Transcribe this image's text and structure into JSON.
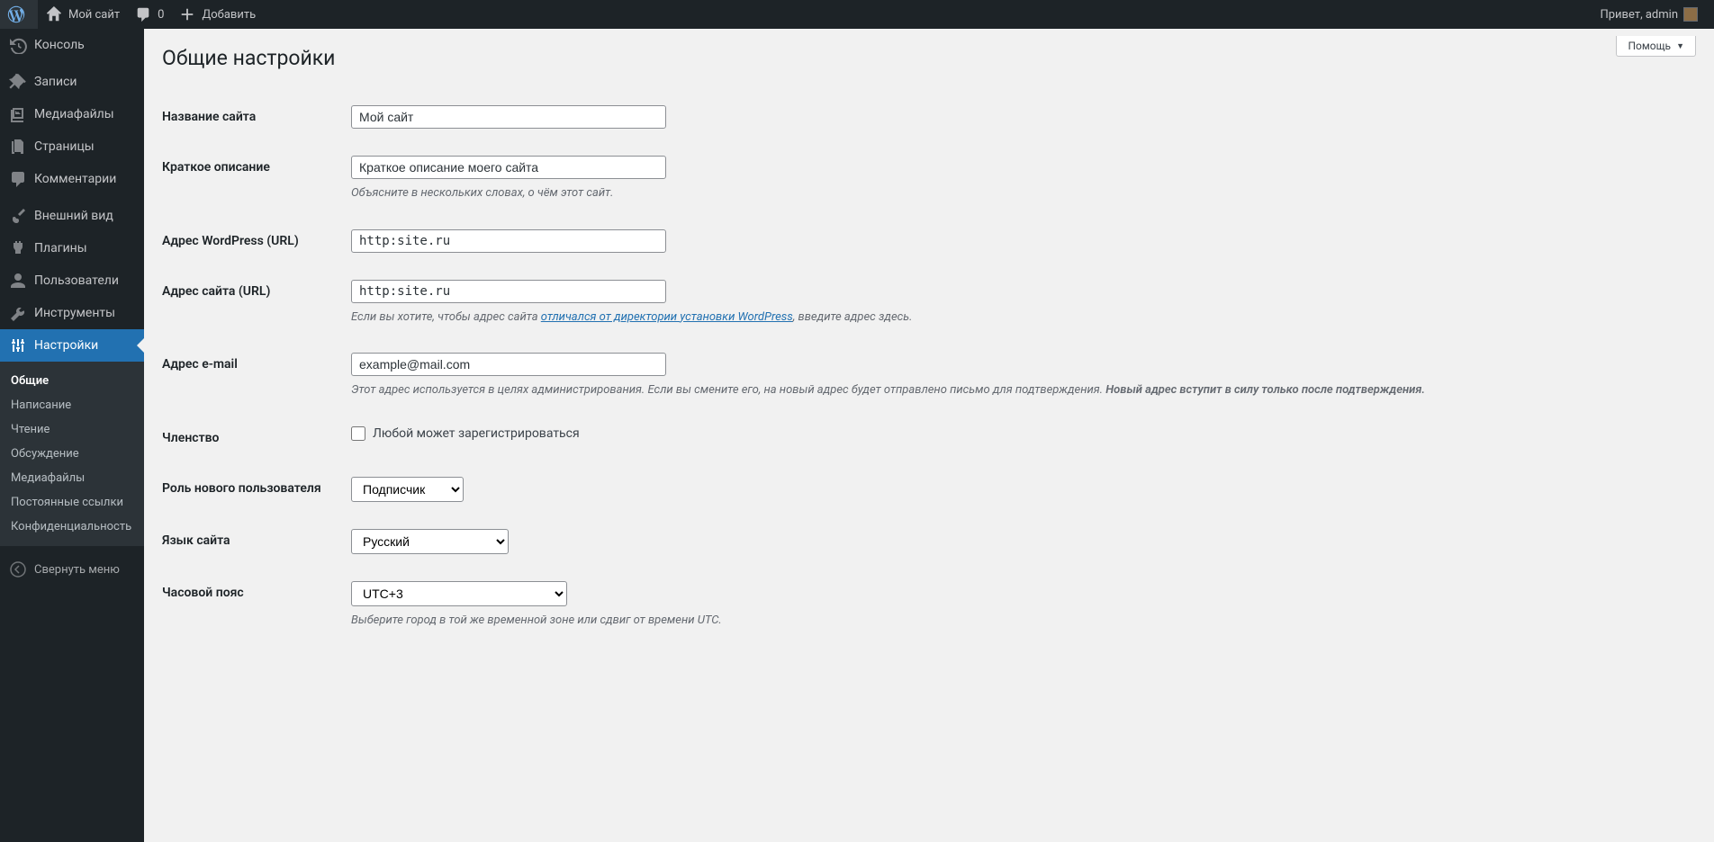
{
  "adminbar": {
    "site_name": "Мой сайт",
    "comments_count": "0",
    "add_new": "Добавить",
    "greeting": "Привет, admin"
  },
  "sidebar": {
    "items": [
      {
        "label": "Консоль"
      },
      {
        "label": "Записи"
      },
      {
        "label": "Медиафайлы"
      },
      {
        "label": "Страницы"
      },
      {
        "label": "Комментарии"
      },
      {
        "label": "Внешний вид"
      },
      {
        "label": "Плагины"
      },
      {
        "label": "Пользователи"
      },
      {
        "label": "Инструменты"
      },
      {
        "label": "Настройки"
      }
    ],
    "submenu": [
      {
        "label": "Общие"
      },
      {
        "label": "Написание"
      },
      {
        "label": "Чтение"
      },
      {
        "label": "Обсуждение"
      },
      {
        "label": "Медиафайлы"
      },
      {
        "label": "Постоянные ссылки"
      },
      {
        "label": "Конфиденциальность"
      }
    ],
    "collapse": "Свернуть меню"
  },
  "help_tab": "Помощь",
  "page_title": "Общие настройки",
  "fields": {
    "site_title": {
      "label": "Название сайта",
      "value": "Мой сайт"
    },
    "tagline": {
      "label": "Краткое описание",
      "value": "Краткое описание моего сайта",
      "desc": "Объясните в нескольких словах, о чём этот сайт."
    },
    "wpurl": {
      "label": "Адрес WordPress (URL)",
      "value": "http:site.ru"
    },
    "siteurl": {
      "label": "Адрес сайта (URL)",
      "value": "http:site.ru",
      "desc_pre": "Если вы хотите, чтобы адрес сайта ",
      "desc_link": "отличался от директории установки WordPress",
      "desc_post": ", введите адрес здесь."
    },
    "email": {
      "label": "Адрес e-mail",
      "value": "example@mail.com",
      "desc_pre": "Этот адрес используется в целях администрирования. Если вы смените его, на новый адрес будет отправлено письмо для подтверждения. ",
      "desc_bold": "Новый адрес вступит в силу только после подтверждения."
    },
    "membership": {
      "label": "Членство",
      "checkbox": "Любой может зарегистрироваться"
    },
    "default_role": {
      "label": "Роль нового пользователя",
      "value": "Подписчик"
    },
    "language": {
      "label": "Язык сайта",
      "value": "Русский"
    },
    "timezone": {
      "label": "Часовой пояс",
      "value": "UTC+3",
      "desc": "Выберите город в той же временной зоне или сдвиг от времени UTC."
    }
  }
}
